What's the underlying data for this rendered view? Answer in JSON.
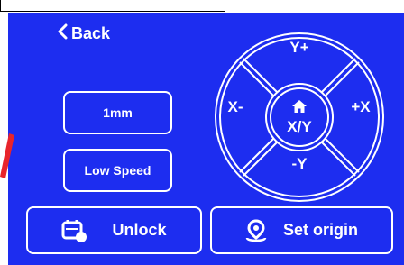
{
  "nav": {
    "back_label": "Back",
    "back_icon": "chevron-left-icon"
  },
  "settings": {
    "step_label": "1mm",
    "speed_label": "Low Speed"
  },
  "jog": {
    "y_plus": "Y+",
    "y_minus": "-Y",
    "x_minus": "X-",
    "x_plus": "+X",
    "home_label": "X/Y",
    "home_icon": "home-icon"
  },
  "actions": {
    "unlock_label": "Unlock",
    "unlock_icon": "unlock-icon",
    "origin_label": "Set origin",
    "origin_icon": "location-pin-icon"
  },
  "colors": {
    "background": "#1d2df0",
    "foreground": "#ffffff",
    "accent_mark": "#e8242b"
  }
}
